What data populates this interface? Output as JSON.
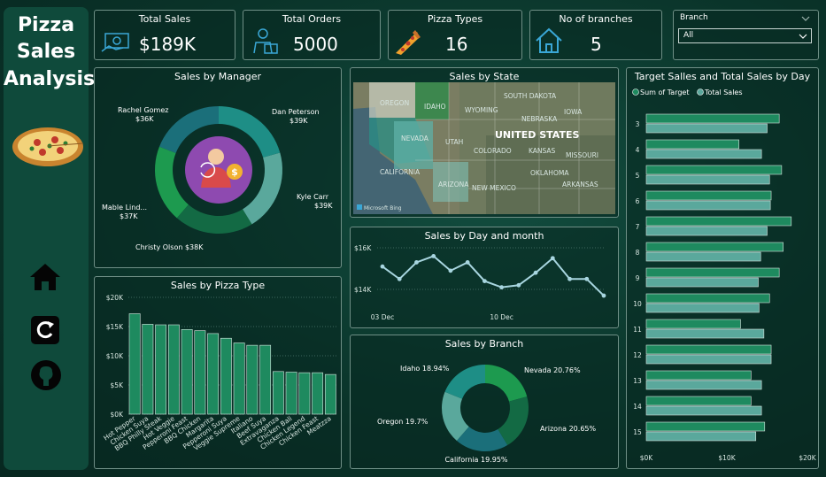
{
  "sidebar": {
    "title_lines": [
      "Pizza",
      "Sales",
      "Analysis"
    ],
    "icons": [
      "pizza-image",
      "home-icon",
      "refresh-icon",
      "github-icon"
    ]
  },
  "kpis": {
    "total_sales": {
      "label": "Total Sales",
      "value": "$189K"
    },
    "total_orders": {
      "label": "Total Orders",
      "value": "5000"
    },
    "pizza_types": {
      "label": "Pizza Types",
      "value": "16"
    },
    "branches": {
      "label": "No of branches",
      "value": "5"
    }
  },
  "filter": {
    "label": "Branch",
    "selected": "All"
  },
  "manager_chart": {
    "title": "Sales by Manager",
    "slices": [
      {
        "name": "Dan Peterson",
        "value": 39,
        "label": "$39K",
        "color": "#1e8e86"
      },
      {
        "name": "Kyle Carr",
        "value": 39,
        "label": "$39K",
        "color": "#5aa89c"
      },
      {
        "name": "Christy Olson",
        "value": 38,
        "label": "Christy Olson $38K",
        "color": "#136a44"
      },
      {
        "name": "Mable Lind...",
        "value": 37,
        "label": "$37K",
        "color": "#1d9a4f"
      },
      {
        "name": "Rachel Gomez",
        "value": 36,
        "label": "$36K",
        "color": "#1b6f7a"
      }
    ]
  },
  "state_map": {
    "title": "Sales by State",
    "labels": [
      "OREGON",
      "IDAHO",
      "WYOMING",
      "SOUTH DAKOTA",
      "IOWA",
      "NEVADA",
      "UTAH",
      "COLORADO",
      "KANSAS",
      "MISSOURI",
      "CALIFORNIA",
      "ARIZONA",
      "NEW MEXICO",
      "OKLAHOMA",
      "ARKANSAS",
      "NEBRASKA"
    ],
    "country": "UNITED STATES",
    "attribution": "Microsoft Bing"
  },
  "target_chart": {
    "title": "Target Salles and Total Sales by Day",
    "legend": [
      {
        "name": "Sum of Target",
        "color": "#1e8a5f"
      },
      {
        "name": "Total Sales",
        "color": "#5aa89c"
      }
    ],
    "days": [
      "3",
      "4",
      "5",
      "6",
      "7",
      "8",
      "9",
      "10",
      "11",
      "12",
      "13",
      "14",
      "15"
    ],
    "target": [
      16.5,
      11.5,
      16.8,
      15.5,
      18.0,
      17.0,
      16.5,
      15.3,
      11.7,
      15.5,
      13.0,
      13.0,
      14.7
    ],
    "sales": [
      15.0,
      14.3,
      15.3,
      15.4,
      15.0,
      14.2,
      13.9,
      14.0,
      14.6,
      15.5,
      14.3,
      14.3,
      13.6
    ],
    "x_ticks": [
      "$0K",
      "$10K",
      "$20K"
    ],
    "x_max": 20
  },
  "day_chart": {
    "title": "Sales by Day and month",
    "values": [
      15.1,
      14.5,
      15.3,
      15.6,
      14.9,
      15.3,
      14.4,
      14.1,
      14.2,
      14.8,
      15.5,
      14.5,
      14.5,
      13.7
    ],
    "y_ticks": [
      "$16K",
      "$14K"
    ],
    "x_ticks": [
      "03 Dec",
      "10 Dec"
    ]
  },
  "pizza_chart": {
    "title": "Sales by Pizza Type",
    "categories": [
      "Hot Pepper",
      "Chicken Suya",
      "BBQ Philly Steak",
      "Hot Veggie",
      "Pepperoni Feast",
      "BBQ Chicken",
      "Margarita",
      "Pepperoni Suya",
      "Veggie Supreme",
      "Italiano",
      "Beef Suya",
      "Extravaganza",
      "Chicken Bali",
      "Chicken Legend",
      "Chicken Feast",
      "Meatzza"
    ],
    "values": [
      17.2,
      15.4,
      15.3,
      15.3,
      14.5,
      14.3,
      13.8,
      13.0,
      12.2,
      11.8,
      11.8,
      7.3,
      7.2,
      7.1,
      7.1,
      6.8
    ],
    "y_ticks": [
      "$20K",
      "$15K",
      "$10K",
      "$5K",
      "$0K"
    ],
    "y_max": 20
  },
  "branch_chart": {
    "title": "Sales by Branch",
    "slices": [
      {
        "name": "Nevada",
        "value": 20.76,
        "label": "Nevada 20.76%",
        "color": "#1d9a4f"
      },
      {
        "name": "Arizona",
        "value": 20.65,
        "label": "Arizona 20.65%",
        "color": "#136a44"
      },
      {
        "name": "California",
        "value": 19.95,
        "label": "California 19.95%",
        "color": "#1b6f7a"
      },
      {
        "name": "Oregon",
        "value": 19.7,
        "label": "Oregon 19.7%",
        "color": "#5aa89c"
      },
      {
        "name": "Idaho",
        "value": 18.94,
        "label": "Idaho 18.94%",
        "color": "#1e8e86"
      }
    ]
  }
}
